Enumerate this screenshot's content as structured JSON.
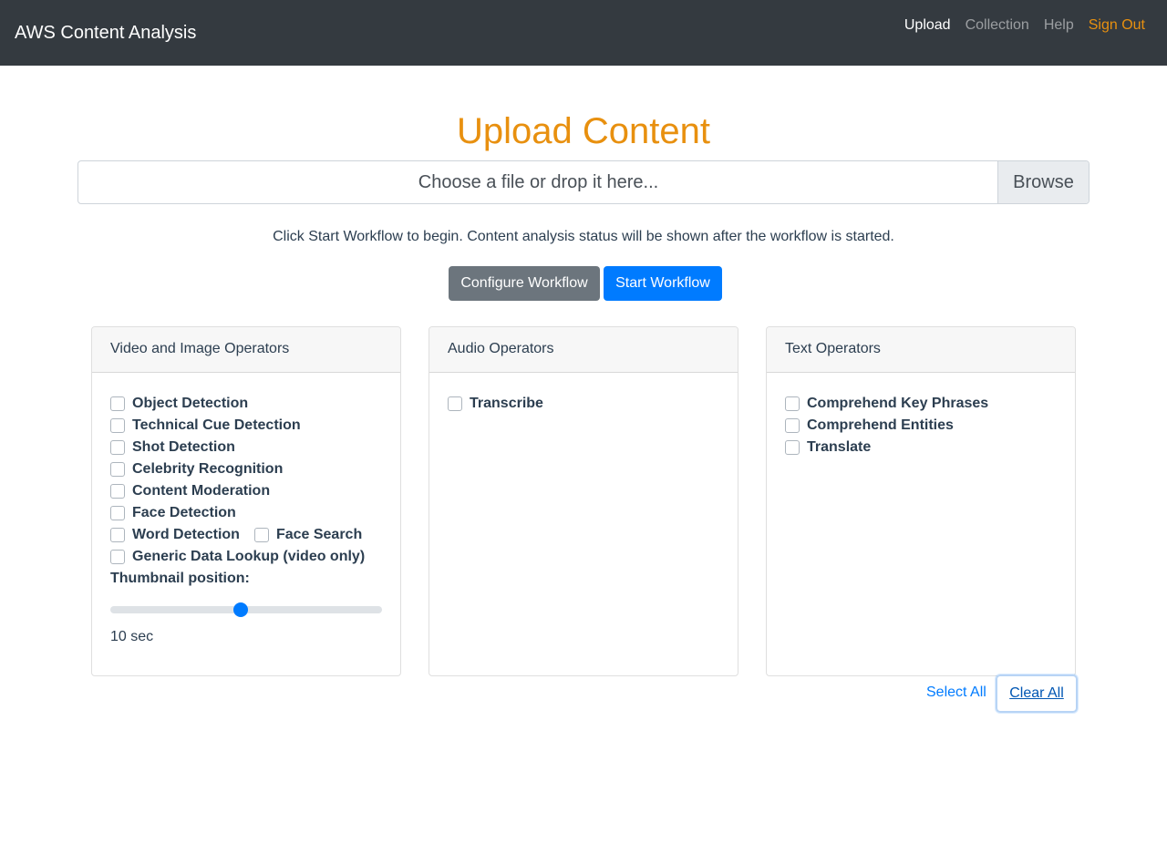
{
  "nav": {
    "brand": "AWS Content Analysis",
    "links": [
      {
        "label": "Upload"
      },
      {
        "label": "Collection"
      },
      {
        "label": "Help"
      },
      {
        "label": "Sign Out"
      }
    ]
  },
  "upload": {
    "title": "Upload Content",
    "file_placeholder": "Choose a file or drop it here...",
    "browse_label": "Browse",
    "instructions": "Click Start Workflow to begin. Content analysis status will be shown after the workflow is started.",
    "configure_label": "Configure Workflow",
    "start_label": "Start Workflow"
  },
  "video_operators": {
    "header": "Video and Image Operators",
    "items": [
      {
        "label": "Object Detection",
        "checked": false
      },
      {
        "label": "Technical Cue Detection",
        "checked": false
      },
      {
        "label": "Shot Detection",
        "checked": false
      },
      {
        "label": "Celebrity Recognition",
        "checked": false
      },
      {
        "label": "Content Moderation",
        "checked": false
      },
      {
        "label": "Face Detection",
        "checked": false
      },
      {
        "label": "Word Detection",
        "checked": false
      },
      {
        "label": "Face Search",
        "checked": false
      },
      {
        "label": "Generic Data Lookup (video only)",
        "checked": false
      }
    ],
    "thumbnail_label": "Thumbnail position:",
    "thumbnail_fraction": 0.48,
    "thumbnail_value": "10 sec"
  },
  "audio_operators": {
    "header": "Audio Operators",
    "items": [
      {
        "label": "Transcribe",
        "checked": false
      }
    ]
  },
  "text_operators": {
    "header": "Text Operators",
    "items": [
      {
        "label": "Comprehend Key Phrases",
        "checked": false
      },
      {
        "label": "Comprehend Entities",
        "checked": false
      },
      {
        "label": "Translate",
        "checked": false
      }
    ]
  },
  "actions": {
    "select_all": "Select All",
    "clear_all": "Clear All"
  },
  "colors": {
    "navbar": "#343a40",
    "accent_orange": "#e8900f",
    "primary_blue": "#007bff",
    "secondary_gray": "#6c757d"
  }
}
